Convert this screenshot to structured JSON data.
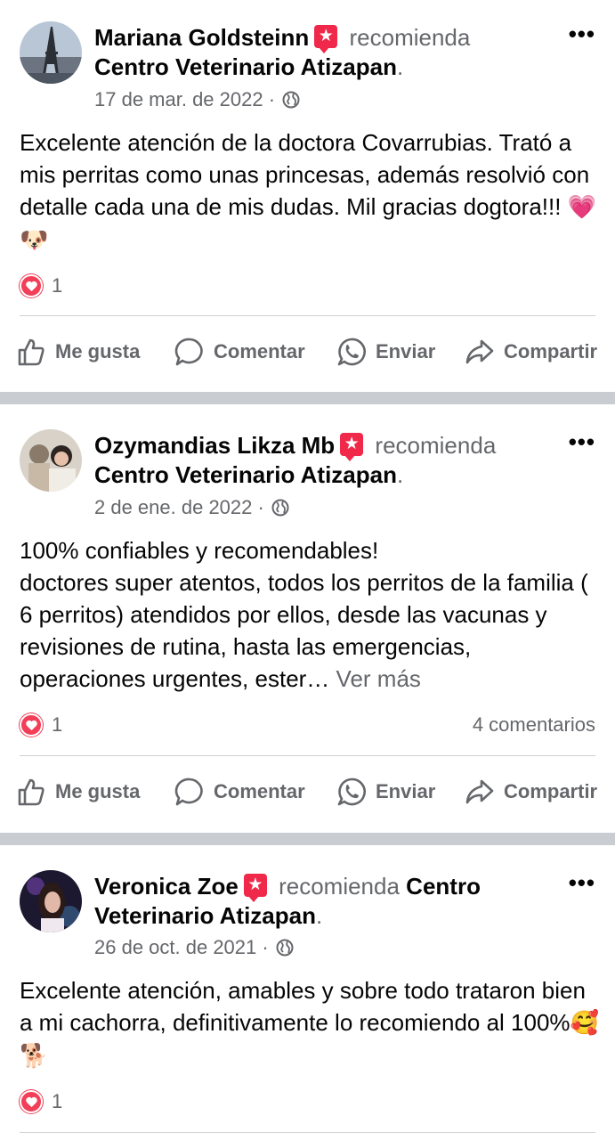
{
  "posts": [
    {
      "author": "Mariana Goldsteinn",
      "verb": "recomienda",
      "page": "Centro  Veterinario Atizapan",
      "date": "17 de mar. de 2022 ·",
      "text": "Excelente atención de la doctora Covarrubias. Trató a mis perritas como unas princesas, además resolvió con detalle cada una de mis dudas. Mil gracias dogtora!!! ",
      "emoji": "💗🐶",
      "see_more": "",
      "reaction_count": "1",
      "comments": "",
      "avatar_icon": "eiffel-tower-photo"
    },
    {
      "author": "Ozymandias Likza Mb",
      "verb": "recomienda",
      "page": "Centro  Veterinario Atizapan",
      "date": "2 de ene. de 2022 ·",
      "text": "100% confiables y recomendables!\ndoctores super atentos, todos los perritos de la familia ( 6 perritos) atendidos por ellos, desde las vacunas y revisiones de rutina, hasta las emergencias, operaciones urgentes, ester… ",
      "emoji": "",
      "see_more": "Ver más",
      "reaction_count": "1",
      "comments": "4 comentarios",
      "avatar_icon": "group-selfie-photo"
    },
    {
      "author": "Veronica Zoe",
      "verb": "recomienda",
      "page": "Centro  Veterinario Atizapan",
      "date": "26 de oct. de 2021 ·",
      "text": "Excelente atención, amables y sobre todo trataron bien a mi cachorra, definitivamente lo recomiendo al 100%",
      "emoji": "🥰🐕",
      "see_more": "",
      "reaction_count": "1",
      "comments": "",
      "avatar_icon": "portrait-photo"
    }
  ],
  "actions": {
    "like": "Me gusta",
    "comment": "Comentar",
    "send": "Enviar",
    "share": "Compartir"
  },
  "colors": {
    "secondary_text": "#65676b",
    "separator": "#c9ccd1",
    "love_reaction": "#f33e58",
    "recommend_badge": "#f02849"
  },
  "icons": [
    "more-options-icon",
    "recommend-icon",
    "globe-icon",
    "heart-reaction-icon",
    "like-icon",
    "comment-icon",
    "whatsapp-icon",
    "share-icon"
  ]
}
